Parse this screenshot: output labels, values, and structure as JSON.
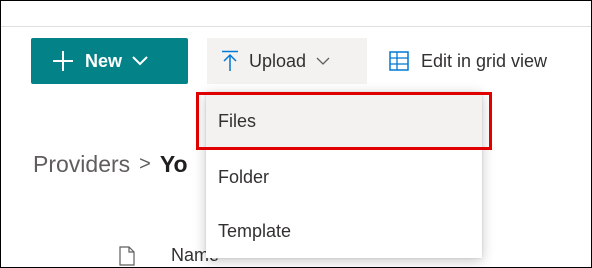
{
  "command_bar": {
    "new_label": "New",
    "upload_label": "Upload",
    "grid_label": "Edit in grid view"
  },
  "breadcrumb": {
    "parent": "Providers",
    "separator": ">",
    "current": "Yo"
  },
  "list_header": {
    "name_label": "Name"
  },
  "upload_menu": {
    "items": [
      {
        "label": "Files",
        "highlighted": true
      },
      {
        "label": "Folder"
      },
      {
        "label": "Template"
      }
    ]
  },
  "colors": {
    "brand": "#038387",
    "highlight_border": "#e00000",
    "hover_bg": "#f3f2f1"
  },
  "icons": {
    "new": "plus-icon",
    "upload": "upload-arrow-icon",
    "grid": "grid-icon",
    "file": "document-icon"
  }
}
